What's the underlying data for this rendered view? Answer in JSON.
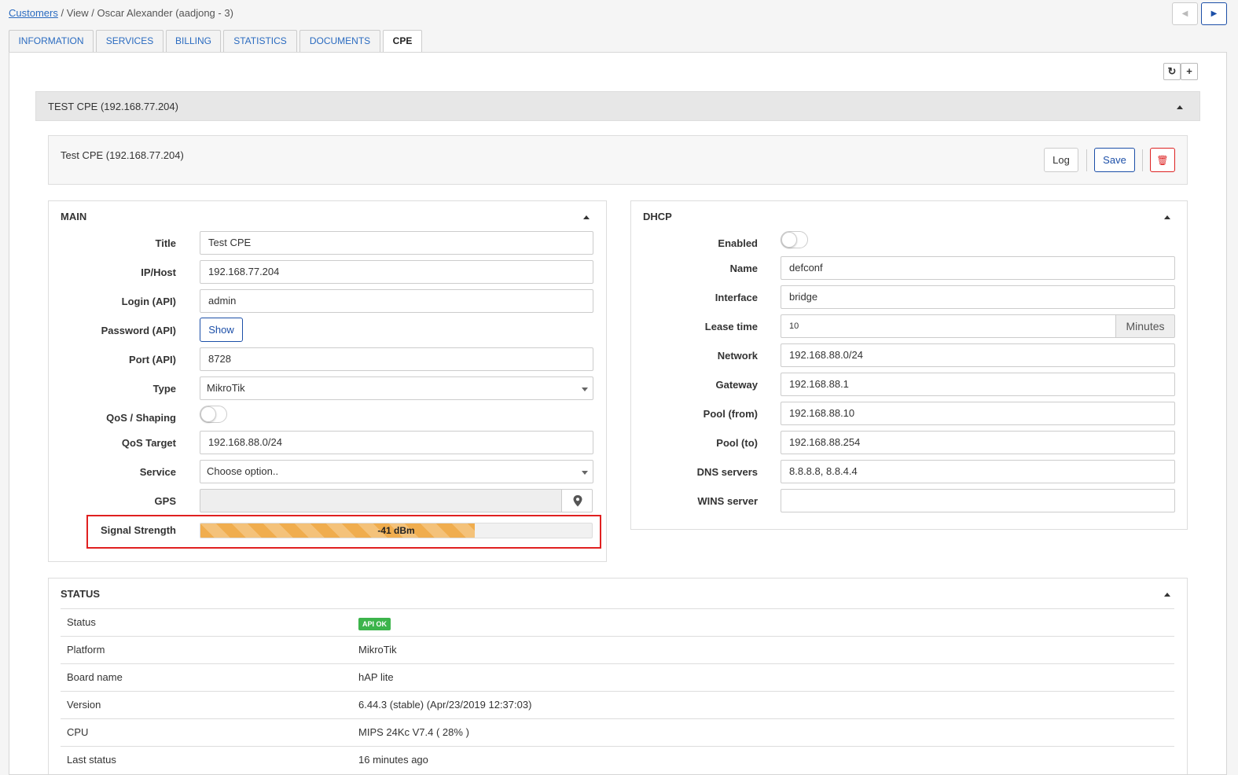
{
  "breadcrumb": {
    "link": "Customers",
    "rest": " / View / Oscar Alexander (aadjong - 3)"
  },
  "pager": {
    "prev": "◀",
    "next": "▶"
  },
  "tabs": [
    {
      "label": "INFORMATION"
    },
    {
      "label": "SERVICES"
    },
    {
      "label": "BILLING"
    },
    {
      "label": "STATISTICS"
    },
    {
      "label": "DOCUMENTS"
    },
    {
      "label": "CPE"
    }
  ],
  "active_tab": "CPE",
  "toolbar": {
    "refresh_icon": "↻",
    "add_icon": "+"
  },
  "cpe": {
    "header_title": "TEST CPE (192.168.77.204)",
    "sub_title": "Test CPE (192.168.77.204)",
    "log_label": "Log",
    "save_label": "Save",
    "delete_icon": "🗑"
  },
  "main": {
    "title": "MAIN",
    "labels": {
      "title": "Title",
      "ip": "IP/Host",
      "login": "Login (API)",
      "password": "Password (API)",
      "port": "Port (API)",
      "type": "Type",
      "qos": "QoS / Shaping",
      "qos_target": "QoS Target",
      "service": "Service",
      "gps": "GPS",
      "signal": "Signal Strength"
    },
    "values": {
      "title": "Test CPE",
      "ip": "192.168.77.204",
      "login": "admin",
      "password_button": "Show",
      "port": "8728",
      "type": "MikroTik",
      "qos_enabled": false,
      "qos_target": "192.168.88.0/24",
      "service": "Choose option..",
      "gps": "",
      "signal_text": "-41 dBm",
      "signal_fraction": 0.7
    }
  },
  "dhcp": {
    "title": "DHCP",
    "labels": {
      "enabled": "Enabled",
      "name": "Name",
      "interface": "Interface",
      "lease": "Lease time",
      "network": "Network",
      "gateway": "Gateway",
      "pool_from": "Pool (from)",
      "pool_to": "Pool (to)",
      "dns": "DNS servers",
      "wins": "WINS server"
    },
    "values": {
      "enabled": false,
      "name": "defconf",
      "interface": "bridge",
      "lease": "10",
      "lease_unit": "Minutes",
      "network": "192.168.88.0/24",
      "gateway": "192.168.88.1",
      "pool_from": "192.168.88.10",
      "pool_to": "192.168.88.254",
      "dns": "8.8.8.8, 8.8.4.4",
      "wins": ""
    }
  },
  "status": {
    "title": "STATUS",
    "rows": [
      {
        "key": "Status",
        "value": "API OK",
        "badge": true
      },
      {
        "key": "Platform",
        "value": "MikroTik"
      },
      {
        "key": "Board name",
        "value": "hAP lite"
      },
      {
        "key": "Version",
        "value": "6.44.3 (stable) (Apr/23/2019 12:37:03)"
      },
      {
        "key": "CPU",
        "value": "MIPS 24Kc V7.4 ( 28% )"
      },
      {
        "key": "Last status",
        "value": "16 minutes ago"
      }
    ]
  },
  "colors": {
    "accent": "#1c4fa8",
    "link": "#2a6bc0",
    "signal_bar": "#f0ad4e",
    "badge_ok": "#3cb44b",
    "highlight": "#e02020"
  }
}
